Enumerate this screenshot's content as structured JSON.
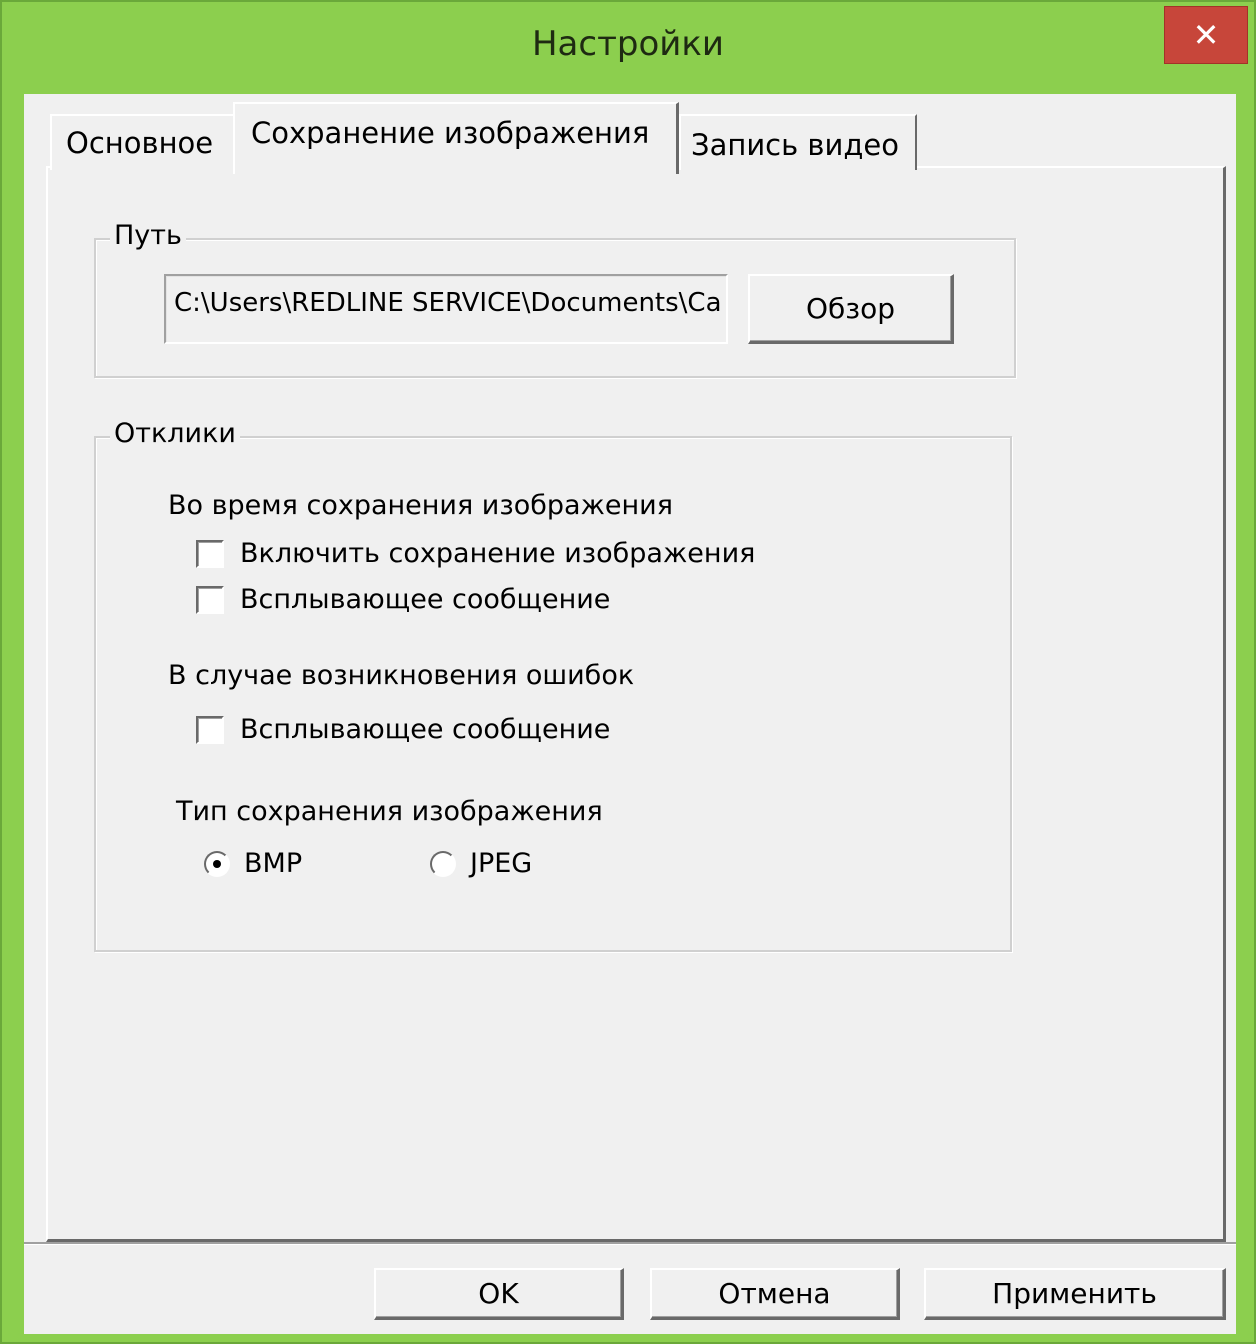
{
  "window": {
    "title": "Настройки",
    "close_glyph": "✕"
  },
  "tabs": [
    {
      "label": "Основное",
      "active": false
    },
    {
      "label": "Сохранение изображения",
      "active": true
    },
    {
      "label": "Запись видео",
      "active": false
    }
  ],
  "path_group": {
    "legend": "Путь",
    "path_value": "C:\\Users\\REDLINE SERVICE\\Documents\\Ca",
    "browse_label": "Обзор"
  },
  "responses_group": {
    "legend": "Отклики",
    "during_save_label": "Во время сохранения изображения",
    "enable_save_label": "Включить сохранение изображения",
    "enable_save_checked": false,
    "popup_during_label": "Всплывающее сообщение",
    "popup_during_checked": false,
    "on_error_label": "В случае возникновения ошибок",
    "popup_error_label": "Всплывающее сообщение",
    "popup_error_checked": false,
    "save_type_label": "Тип сохранения изображения",
    "bmp_label": "BMP",
    "jpeg_label": "JPEG",
    "selected_type": "BMP"
  },
  "footer": {
    "ok_label": "OK",
    "cancel_label": "Отмена",
    "apply_label": "Применить"
  },
  "colors": {
    "frame": "#8ccf4e",
    "close_button": "#c7463a",
    "dialog_bg": "#f0f0f0"
  }
}
